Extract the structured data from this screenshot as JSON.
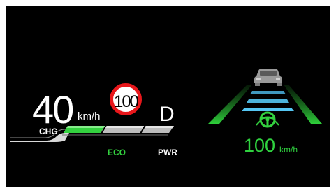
{
  "speed": {
    "value": "40",
    "unit": "km/h"
  },
  "speed_limit_sign": {
    "value": "100"
  },
  "gear": "D",
  "power_meter": {
    "charge_label": "CHG",
    "eco_label": "ECO",
    "power_label": "PWR",
    "eco_fill_fraction": 0.35
  },
  "driver_assist": {
    "set_speed_value": "100",
    "set_speed_unit": "km/h"
  },
  "colors": {
    "screen_background": "#000000",
    "text": "#ffffff",
    "sign_ring": "#e8171b",
    "eco_green": "#33d13f",
    "lane_green": "#2ecf3a",
    "distance_blue": "#55c6f2",
    "vehicle_gray": "#9a9a9a"
  },
  "icons": [
    "lead-vehicle-icon",
    "steering-wheel-icon"
  ]
}
